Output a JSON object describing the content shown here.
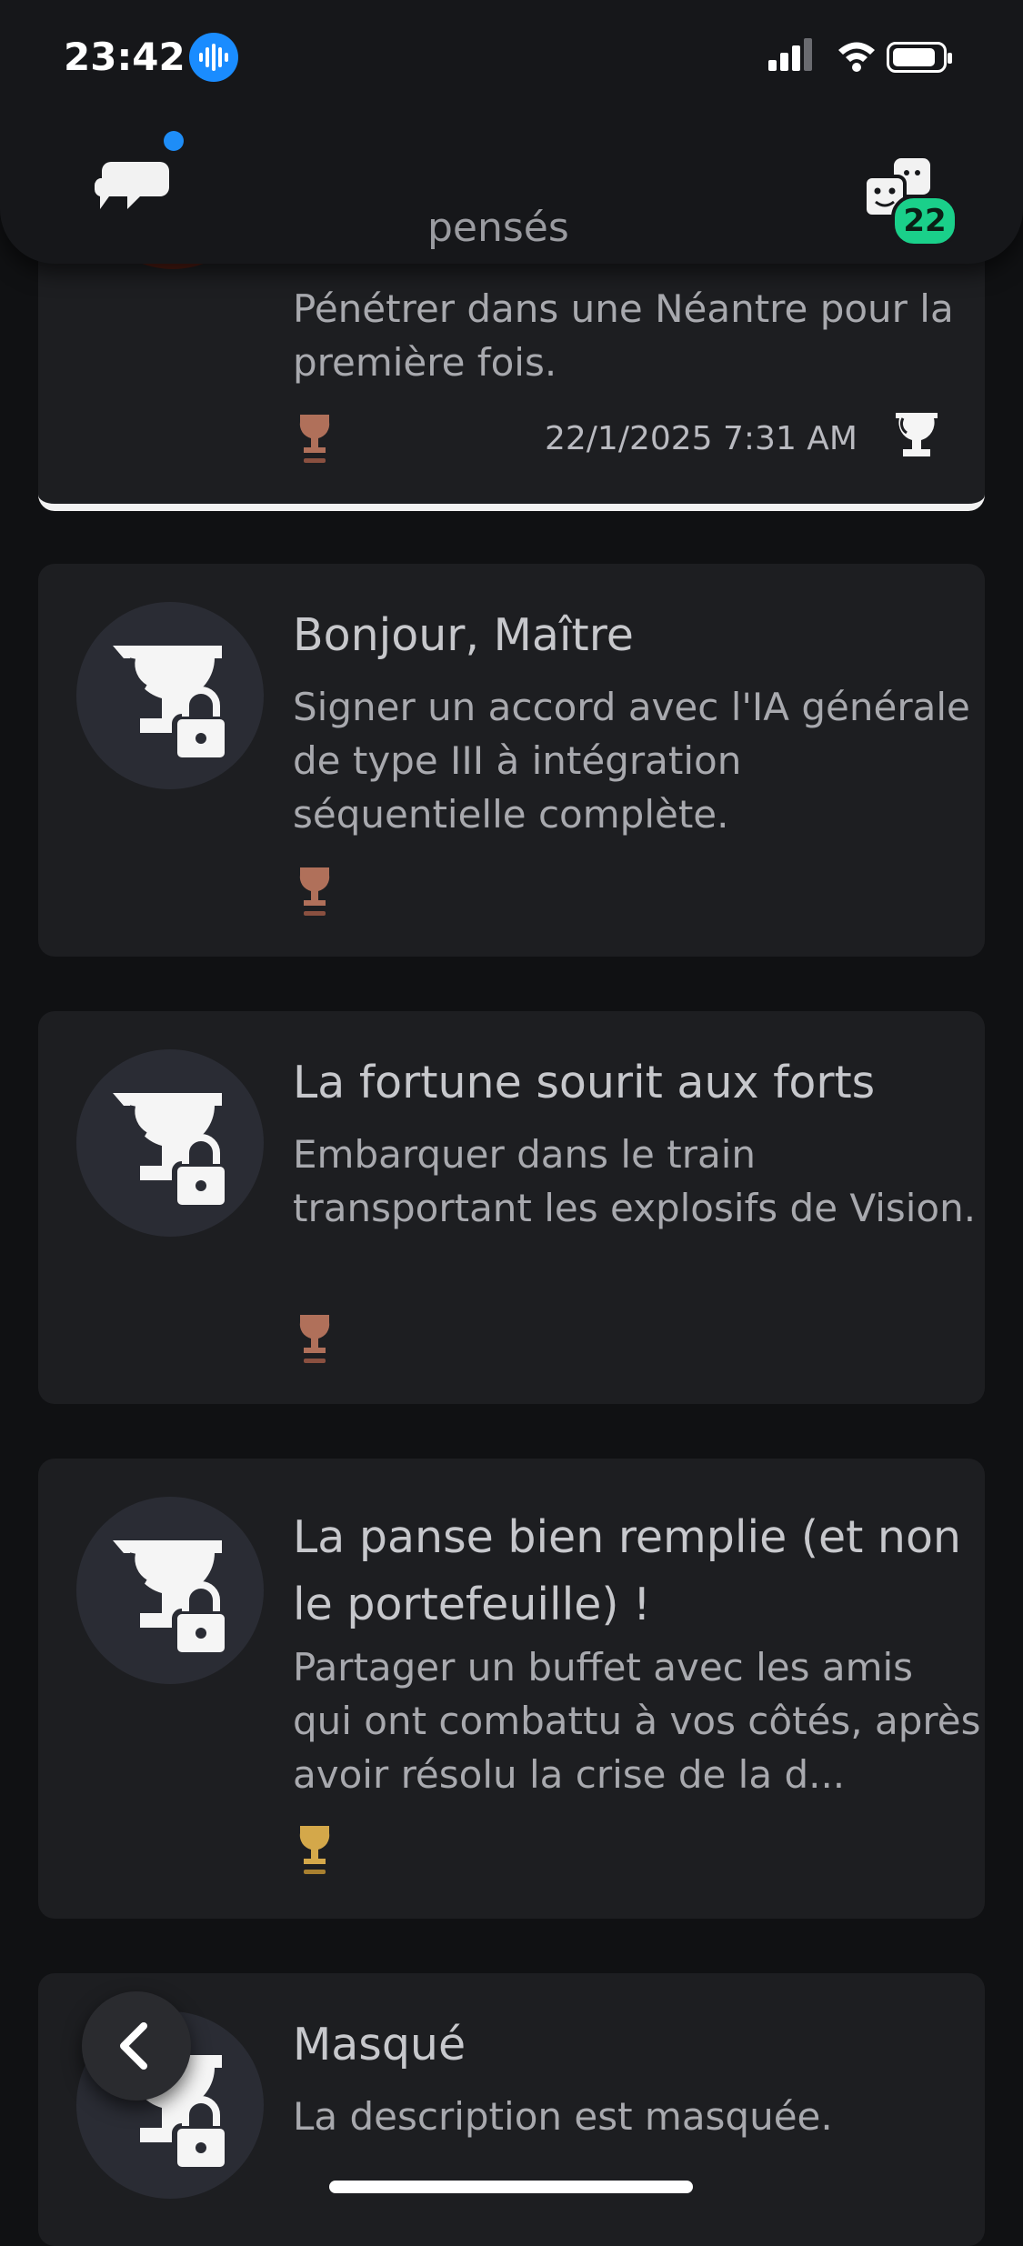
{
  "status_bar": {
    "time": "23:42"
  },
  "header": {
    "party_badge": "22",
    "partial_tab_text": "pensés"
  },
  "trophies": [
    {
      "title": "",
      "description": "Pénétrer dans une Néantre pour la première fois.",
      "grade": "bronze",
      "earned_date": "22/1/2025  7:31 AM",
      "earned": true
    },
    {
      "title": "Bonjour, Maître",
      "description": "Signer un accord avec l'IA générale de type III à intégration séquentielle complète.",
      "grade": "bronze",
      "earned": false
    },
    {
      "title": "La fortune sourit aux forts",
      "description": "Embarquer dans le train transportant les explosifs de Vision.",
      "grade": "bronze",
      "earned": false
    },
    {
      "title": "La panse bien remplie (et non le portefeuille) !",
      "description": "Partager un buffet avec les amis qui ont combattu à vos côtés, après avoir résolu la crise de la d...",
      "grade": "gold",
      "earned": false
    },
    {
      "title": "Masqué",
      "description": "La description est masquée.",
      "grade": "hidden",
      "earned": false
    }
  ],
  "colors": {
    "background": "#101113",
    "card": "#1d1e21",
    "bronze": "#b0705a",
    "gold": "#d4a84a",
    "accent_green": "#1ad08a",
    "accent_blue": "#1e8df7"
  },
  "icons": [
    "chat-icon",
    "party-icon",
    "trophy-lock-icon",
    "bronze-cup-icon",
    "gold-cup-icon",
    "back-chevron-icon"
  ]
}
